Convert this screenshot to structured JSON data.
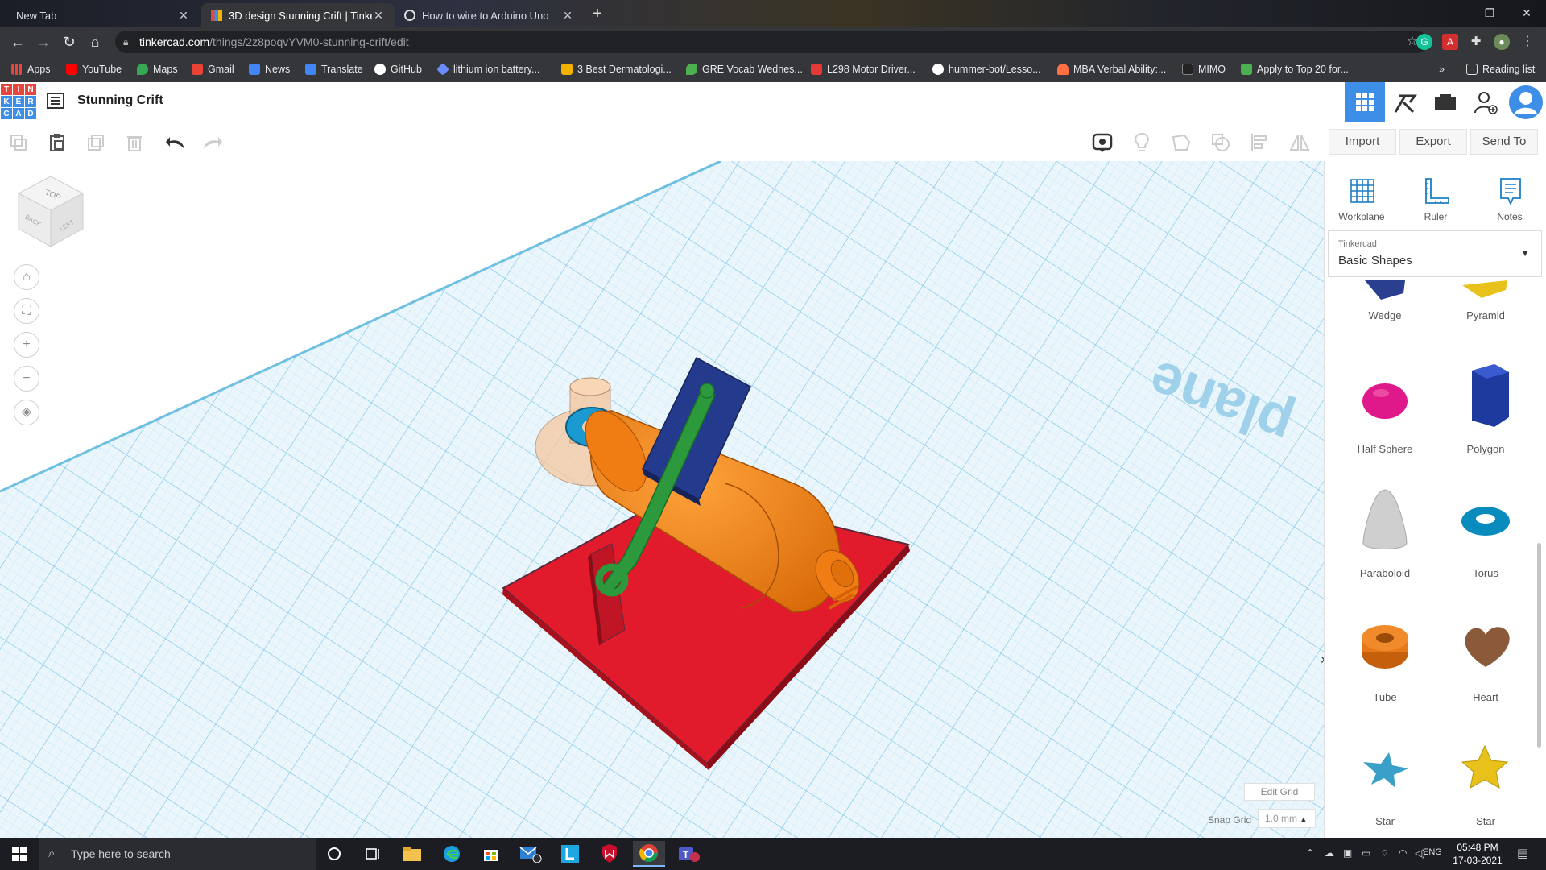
{
  "browser": {
    "tabs": [
      {
        "title": "New Tab",
        "active": false
      },
      {
        "title": "3D design Stunning Crift | Tinker",
        "active": true
      },
      {
        "title": "How to wire to Arduino Uno",
        "active": false
      }
    ],
    "url_host": "tinkercad.com",
    "url_path": "/things/2z8poqvYVM0-stunning-crift/edit",
    "bookmarks": [
      {
        "label": "Apps",
        "icon": "apps-grid-icon",
        "color": "#e8453c"
      },
      {
        "label": "YouTube",
        "icon": "youtube-icon",
        "color": "#ff0000"
      },
      {
        "label": "Maps",
        "icon": "maps-icon",
        "color": "#34a853"
      },
      {
        "label": "Gmail",
        "icon": "gmail-icon",
        "color": "#ea4335"
      },
      {
        "label": "News",
        "icon": "news-icon",
        "color": "#4285f4"
      },
      {
        "label": "Translate",
        "icon": "translate-icon",
        "color": "#4285f4"
      },
      {
        "label": "GitHub",
        "icon": "github-icon",
        "color": "#ffffff"
      },
      {
        "label": "lithium ion battery...",
        "icon": "diamond-icon",
        "color": "#6b8cff"
      },
      {
        "label": "3 Best Dermatologi...",
        "icon": "star-box-icon",
        "color": "#f2b300"
      },
      {
        "label": "GRE Vocab Wednes...",
        "icon": "leaf-icon",
        "color": "#4caf50"
      },
      {
        "label": "L298 Motor Driver...",
        "icon": "chip-icon",
        "color": "#e53935"
      },
      {
        "label": "hummer-bot/Lesso...",
        "icon": "github-icon",
        "color": "#ffffff"
      },
      {
        "label": "MBA Verbal Ability:...",
        "icon": "cloud-icon",
        "color": "#ff7043"
      },
      {
        "label": "MIMO",
        "icon": "mimo-icon",
        "color": "#222222"
      },
      {
        "label": "Apply to Top 20 for...",
        "icon": "yc-icon",
        "color": "#4caf50"
      }
    ],
    "reading_list": "Reading list"
  },
  "app": {
    "logo_letters": [
      "T",
      "I",
      "N",
      "K",
      "E",
      "R",
      "C",
      "A",
      "D"
    ],
    "design_title": "Stunning Crift",
    "header_buttons": [
      "3d-view-icon",
      "codeblocks-icon",
      "lesson-plans-icon",
      "add-user-icon",
      "avatar"
    ]
  },
  "edit_toolbar": {
    "import_label": "Import",
    "export_label": "Export",
    "send_to_label": "Send To"
  },
  "viewcube": {
    "top": "TOP",
    "back": "BACK",
    "left": "LEFT"
  },
  "workplane_text": "plane",
  "grid": {
    "edit_grid_label": "Edit Grid",
    "snap_grid_label": "Snap Grid",
    "snap_grid_value": "1.0 mm"
  },
  "panel": {
    "tools": [
      {
        "label": "Workplane",
        "icon": "workplane-icon"
      },
      {
        "label": "Ruler",
        "icon": "ruler-icon"
      },
      {
        "label": "Notes",
        "icon": "notes-icon"
      }
    ],
    "library_category": "Tinkercad",
    "library_value": "Basic Shapes",
    "shapes": [
      {
        "label": "Wedge",
        "color": "#2a3f8f"
      },
      {
        "label": "Pyramid",
        "color": "#e8c21a"
      },
      {
        "label": "Half Sphere",
        "color": "#e0198a"
      },
      {
        "label": "Polygon",
        "color": "#1f3a9e"
      },
      {
        "label": "Paraboloid",
        "color": "#cfcfcf"
      },
      {
        "label": "Torus",
        "color": "#0a8bbd"
      },
      {
        "label": "Tube",
        "color": "#e77817"
      },
      {
        "label": "Heart",
        "color": "#8a5a3a"
      },
      {
        "label": "Star",
        "color": "#3aa0c8"
      },
      {
        "label": "Star",
        "color": "#e8c21a"
      }
    ]
  },
  "taskbar": {
    "search_placeholder": "Type here to search",
    "language": "ENG",
    "time": "05:48 PM",
    "date": "17-03-2021"
  },
  "colors": {
    "accent": "#3c8ee6",
    "base_plate": "#e21b2c",
    "body": "#f07c14",
    "panel": "#243a8c",
    "arm": "#2c9a3c",
    "grid": "#8fd0ec"
  }
}
